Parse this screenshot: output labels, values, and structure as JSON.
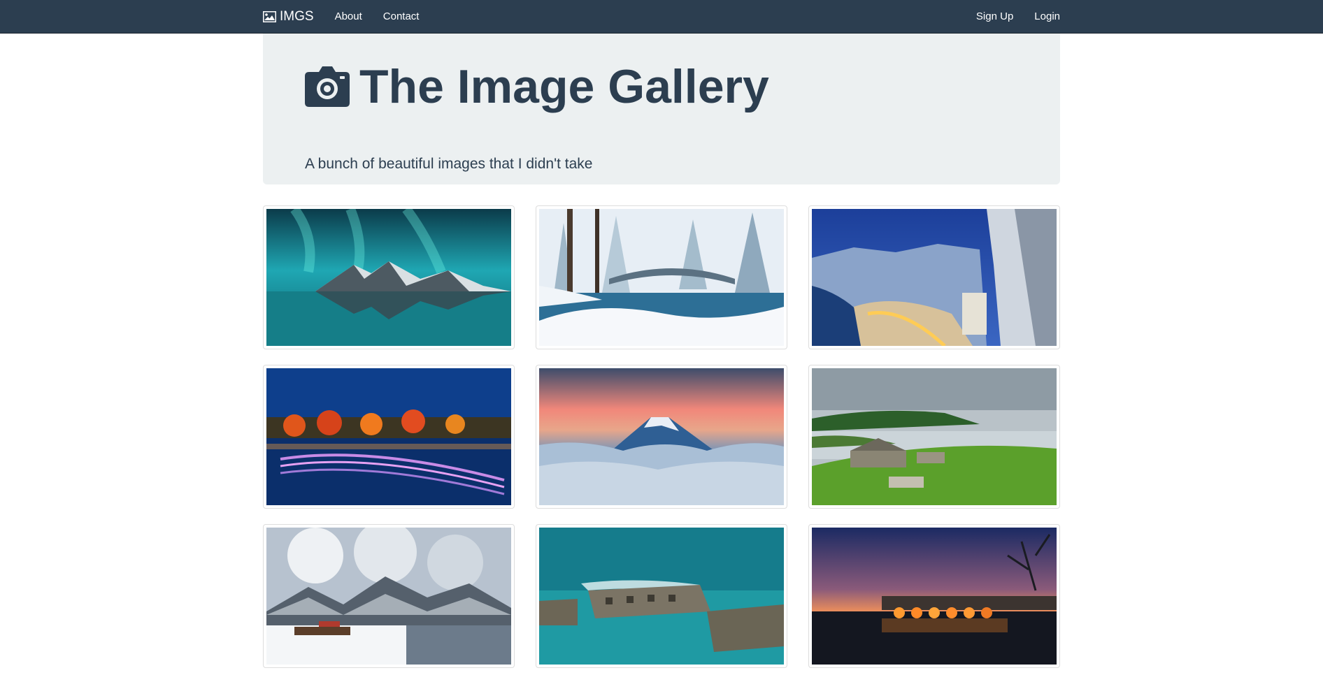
{
  "navbar": {
    "brand": "IMGS",
    "brand_icon": "picture-icon",
    "links_left": [
      "About",
      "Contact"
    ],
    "links_right": [
      "Sign Up",
      "Login"
    ]
  },
  "jumbotron": {
    "icon": "camera-icon",
    "title": "The Image Gallery",
    "lead": "A bunch of beautiful images that I didn't take"
  },
  "gallery": {
    "images": [
      {
        "name": "aurora-mountain-lake"
      },
      {
        "name": "snowy-forest-bridge"
      },
      {
        "name": "winter-city-night"
      },
      {
        "name": "night-lights-river"
      },
      {
        "name": "mountain-above-clouds"
      },
      {
        "name": "green-coast-cottages"
      },
      {
        "name": "foggy-lake-boat"
      },
      {
        "name": "aerial-ocean-ruins"
      },
      {
        "name": "sunset-arch-bridge"
      }
    ]
  },
  "colors": {
    "navbar": "#2c3e50",
    "jumbotron": "#ecf0f1",
    "text": "#2c3e50"
  }
}
